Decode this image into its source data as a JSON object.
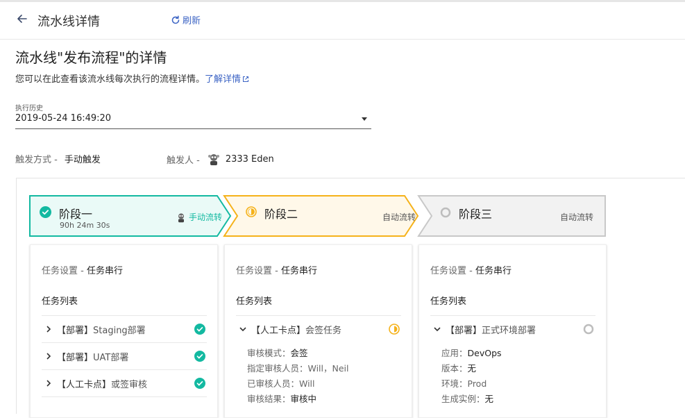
{
  "header": {
    "title": "流水线详情",
    "refresh_label": "刷新"
  },
  "page": {
    "title": "流水线\"发布流程\"的详情",
    "description": "您可以在此查看该流水线每次执行的流程详情。",
    "learn_more": "了解详情"
  },
  "history": {
    "label": "执行历史",
    "selected": "2019-05-24 16:49:20"
  },
  "meta": {
    "trigger_label": "触发方式 -",
    "trigger_value": "手动触发",
    "triggerer_label": "触发人 -",
    "triggerer_value": "2333 Eden"
  },
  "colors": {
    "accent": "#3b63c4",
    "success": "#13b9a1",
    "pending": "#f5b21a",
    "idle": "#bdbdbd"
  },
  "stages": [
    {
      "name": "阶段一",
      "duration": "90h 24m 30s",
      "transfer": "手动流转",
      "status": "success"
    },
    {
      "name": "阶段二",
      "duration": "",
      "transfer": "自动流转",
      "status": "running"
    },
    {
      "name": "阶段三",
      "duration": "",
      "transfer": "自动流转",
      "status": "idle"
    }
  ],
  "cards": [
    {
      "setting_label": "任务设置 -",
      "setting_value": "任务串行",
      "list_title": "任务列表",
      "tasks": [
        {
          "tag": "【部署】",
          "name": "Staging部署",
          "status": "success"
        },
        {
          "tag": "【部署】",
          "name": "UAT部署",
          "status": "success"
        },
        {
          "tag": "【人工卡点】",
          "name": "或签审核",
          "status": "success"
        }
      ]
    },
    {
      "setting_label": "任务设置 -",
      "setting_value": "任务串行",
      "list_title": "任务列表",
      "tasks": [
        {
          "tag": "【人工卡点】",
          "name": "会签任务",
          "status": "running",
          "details": [
            {
              "k": "审核模式：",
              "v": "会签"
            },
            {
              "k": "指定审核人员：Will，Neil",
              "v": ""
            },
            {
              "k": "已审核人员：Will",
              "v": ""
            },
            {
              "k": "审核结果：",
              "v": "审核中"
            }
          ]
        }
      ]
    },
    {
      "setting_label": "任务设置 -",
      "setting_value": "任务串行",
      "list_title": "任务列表",
      "tasks": [
        {
          "tag": "【部署】",
          "name": "正式环境部署",
          "status": "idle",
          "details": [
            {
              "k": "应用：",
              "v": "DevOps"
            },
            {
              "k": "版本：",
              "v": "无"
            },
            {
              "k": "环境：Prod",
              "v": ""
            },
            {
              "k": "生成实例：",
              "v": "无"
            }
          ]
        }
      ]
    }
  ]
}
